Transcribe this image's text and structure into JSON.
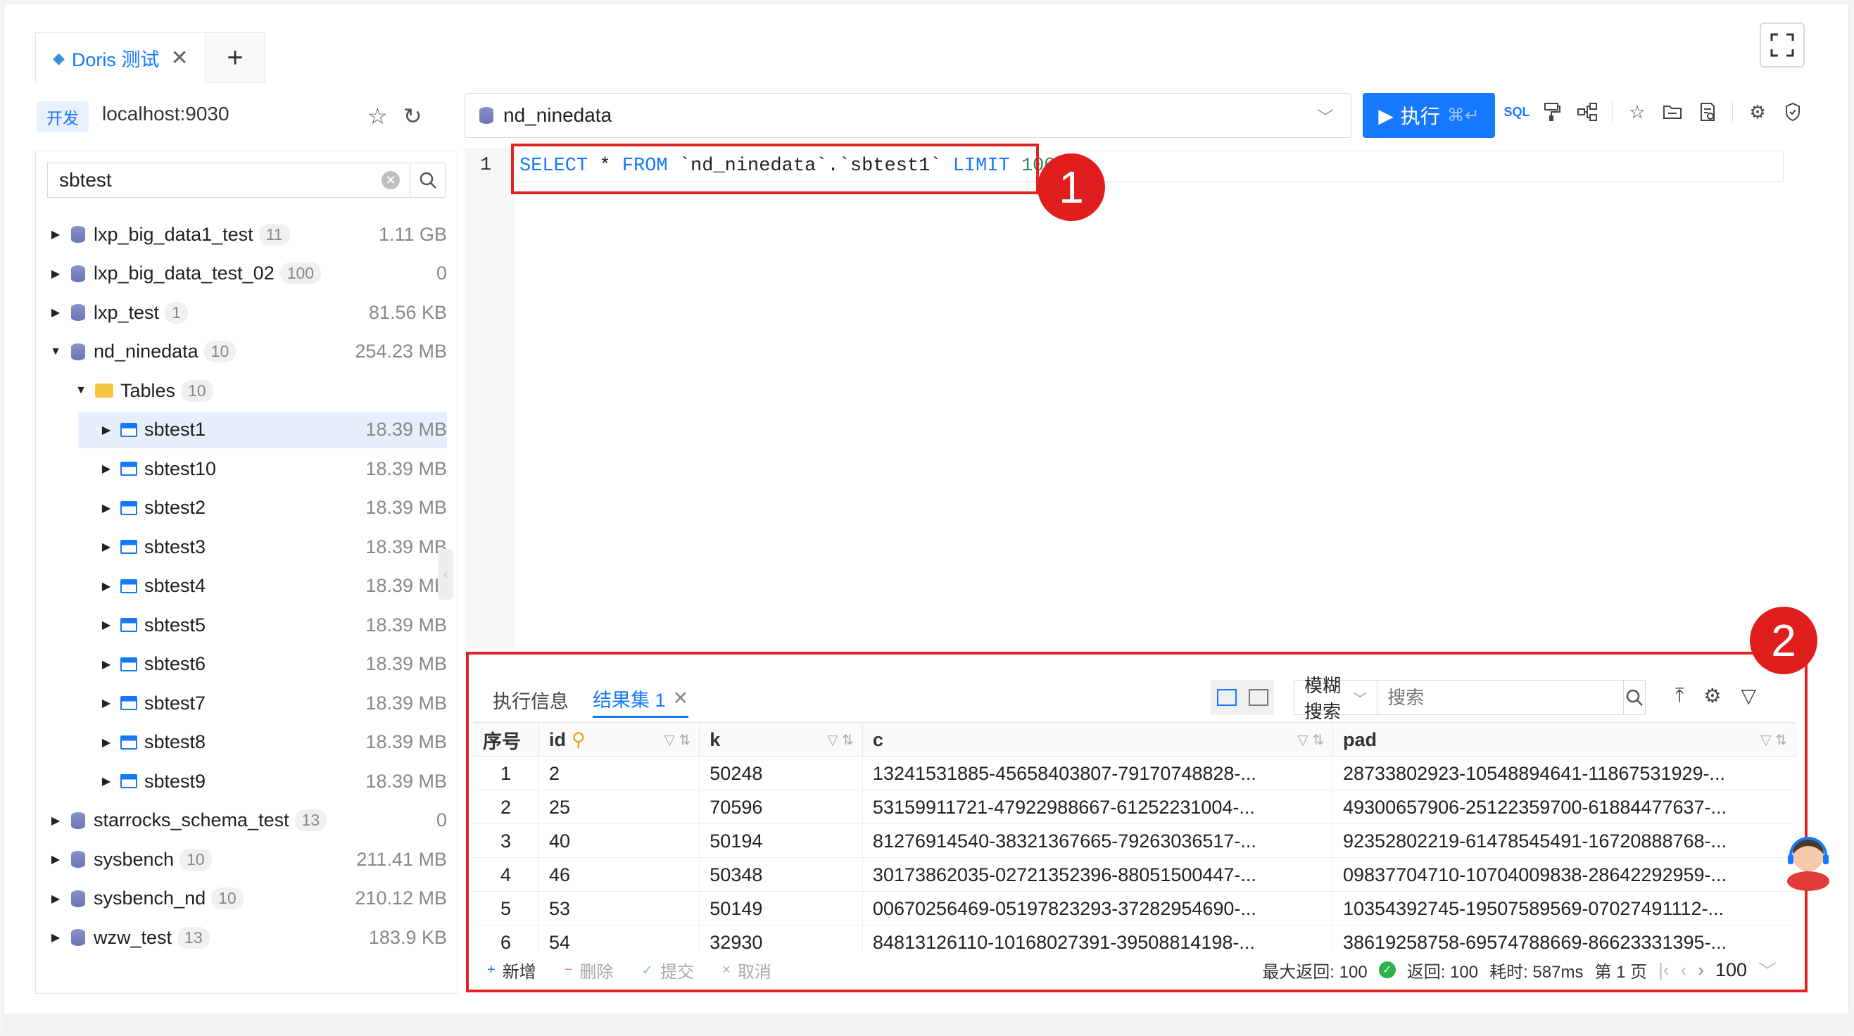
{
  "tabs": [
    {
      "label": "Doris 测试",
      "close": "✕"
    }
  ],
  "add_tab": "+",
  "connection": {
    "env_tag": "开发",
    "host": "localhost:9030"
  },
  "tree_search": {
    "value": "sbtest"
  },
  "tree": [
    {
      "name": "lxp_big_data1_test",
      "count": "11",
      "size": "1.11 GB",
      "kind": "db",
      "level": 0,
      "expanded": false
    },
    {
      "name": "lxp_big_data_test_02",
      "count": "100",
      "size": "0",
      "kind": "db",
      "level": 0,
      "expanded": false
    },
    {
      "name": "lxp_test",
      "count": "1",
      "size": "81.56 KB",
      "kind": "db",
      "level": 0,
      "expanded": false
    },
    {
      "name": "nd_ninedata",
      "count": "10",
      "size": "254.23 MB",
      "kind": "db",
      "level": 0,
      "expanded": true
    },
    {
      "name": "Tables",
      "count": "10",
      "size": "",
      "kind": "folder",
      "level": 1,
      "expanded": true
    },
    {
      "name": "sbtest1",
      "count": "",
      "size": "18.39 MB",
      "kind": "table",
      "level": 2,
      "selected": true
    },
    {
      "name": "sbtest10",
      "count": "",
      "size": "18.39 MB",
      "kind": "table",
      "level": 2
    },
    {
      "name": "sbtest2",
      "count": "",
      "size": "18.39 MB",
      "kind": "table",
      "level": 2
    },
    {
      "name": "sbtest3",
      "count": "",
      "size": "18.39 MB",
      "kind": "table",
      "level": 2
    },
    {
      "name": "sbtest4",
      "count": "",
      "size": "18.39 MB",
      "kind": "table",
      "level": 2
    },
    {
      "name": "sbtest5",
      "count": "",
      "size": "18.39 MB",
      "kind": "table",
      "level": 2
    },
    {
      "name": "sbtest6",
      "count": "",
      "size": "18.39 MB",
      "kind": "table",
      "level": 2
    },
    {
      "name": "sbtest7",
      "count": "",
      "size": "18.39 MB",
      "kind": "table",
      "level": 2
    },
    {
      "name": "sbtest8",
      "count": "",
      "size": "18.39 MB",
      "kind": "table",
      "level": 2
    },
    {
      "name": "sbtest9",
      "count": "",
      "size": "18.39 MB",
      "kind": "table",
      "level": 2
    },
    {
      "name": "starrocks_schema_test",
      "count": "13",
      "size": "0",
      "kind": "db",
      "level": 0,
      "expanded": false
    },
    {
      "name": "sysbench",
      "count": "10",
      "size": "211.41 MB",
      "kind": "db",
      "level": 0,
      "expanded": false
    },
    {
      "name": "sysbench_nd",
      "count": "10",
      "size": "210.12 MB",
      "kind": "db",
      "level": 0,
      "expanded": false
    },
    {
      "name": "wzw_test",
      "count": "13",
      "size": "183.9 KB",
      "kind": "db",
      "level": 0,
      "expanded": false
    }
  ],
  "editor": {
    "database": "nd_ninedata",
    "run_label": "执行",
    "run_shortcut": "⌘↵",
    "line_number": "1",
    "sql_tokens": [
      {
        "t": "SELECT",
        "c": "kw"
      },
      {
        "t": " * ",
        "c": "plain"
      },
      {
        "t": "FROM",
        "c": "kw"
      },
      {
        "t": " `nd_ninedata`.`sbtest1` ",
        "c": "plain"
      },
      {
        "t": "LIMIT",
        "c": "kw"
      },
      {
        "t": " ",
        "c": "plain"
      },
      {
        "t": "100",
        "c": "num"
      },
      {
        "t": ";",
        "c": "plain"
      }
    ],
    "sql_badge_text": "SQL"
  },
  "annotations": {
    "one": "1",
    "two": "2"
  },
  "results": {
    "tabs": [
      {
        "label": "执行信息",
        "active": false
      },
      {
        "label": "结果集 1",
        "active": true,
        "close": "✕"
      }
    ],
    "search_mode": "模糊搜索",
    "search_placeholder": "搜索",
    "columns": [
      "序号",
      "id",
      "k",
      "c",
      "pad"
    ],
    "rows": [
      [
        "1",
        "2",
        "50248",
        "13241531885-45658403807-79170748828-...",
        "28733802923-10548894641-11867531929-..."
      ],
      [
        "2",
        "25",
        "70596",
        "53159911721-47922988667-61252231004-...",
        "49300657906-25122359700-61884477637-..."
      ],
      [
        "3",
        "40",
        "50194",
        "81276914540-38321367665-79263036517-...",
        "92352802219-61478545491-16720888768-..."
      ],
      [
        "4",
        "46",
        "50348",
        "30173862035-02721352396-88051500447-...",
        "09837704710-10704009838-28642292959-..."
      ],
      [
        "5",
        "53",
        "50149",
        "00670256469-05197823293-37282954690-...",
        "10354392745-19507589569-07027491112-..."
      ],
      [
        "6",
        "54",
        "32930",
        "84813126110-10168027391-39508814198-...",
        "38619258758-69574788669-86623331395-..."
      ]
    ],
    "footer": {
      "add": "新增",
      "delete": "删除",
      "submit": "提交",
      "cancel": "取消",
      "max_return": "最大返回: 100",
      "returned": "返回: 100",
      "elapsed": "耗时: 587ms",
      "page": "第 1 页",
      "page_size": "100"
    }
  },
  "colors": {
    "accent": "#1677ff",
    "annotation_red": "#e01e1e",
    "success": "#2bb24c"
  }
}
